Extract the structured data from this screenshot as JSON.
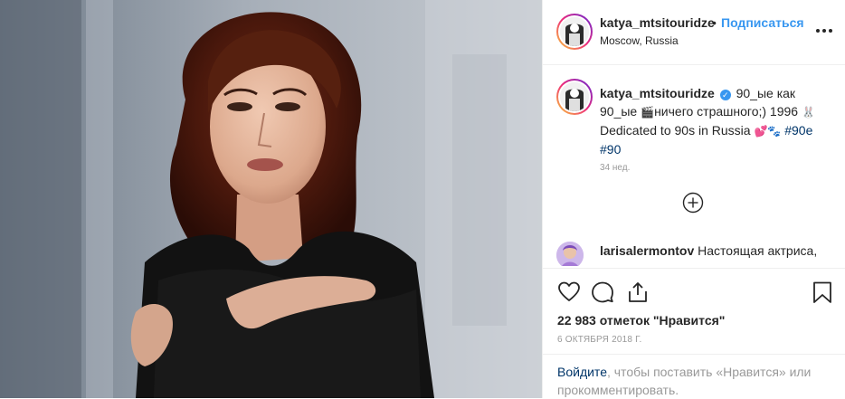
{
  "header": {
    "username": "katya_mtsitouridze",
    "separator": "•",
    "follow_label": "Подписаться",
    "location": "Moscow, Russia"
  },
  "caption": {
    "username": "katya_mtsitouridze",
    "text_part1": "90_ые как 90_ые",
    "text_part2": "ничего страшного;) 1996",
    "text_part3": "Dedicated to 90s in Russia",
    "hashtag1": "#90е",
    "hashtag2": "#90",
    "time_ago": "34 нед."
  },
  "comments": [
    {
      "username": "larisalermontov",
      "text": "Настоящая актриса,"
    }
  ],
  "actions": {
    "likes_text": "22 983 отметок \"Нравится\"",
    "date": "6 ОКТЯБРЯ 2018 Г."
  },
  "login_prompt": {
    "link": "Войдите",
    "text": ", чтобы поставить «Нравится» или прокомментировать."
  },
  "colors": {
    "accent": "#3897f0",
    "text": "#262626",
    "muted": "#999999",
    "link": "#003569",
    "border": "#efefef"
  },
  "icons": [
    "more-icon",
    "verified-icon",
    "load-more-icon",
    "heart-icon",
    "comment-icon",
    "share-icon",
    "bookmark-icon"
  ]
}
